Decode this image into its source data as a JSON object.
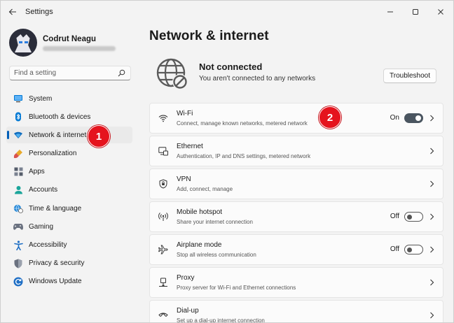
{
  "window": {
    "title": "Settings",
    "controls": [
      "minimize-icon",
      "maximize-icon",
      "close-icon"
    ]
  },
  "profile": {
    "name": "Codrut Neagu"
  },
  "search": {
    "placeholder": "Find a setting"
  },
  "sidebar": {
    "items": [
      {
        "label": "System",
        "icon": "system-icon"
      },
      {
        "label": "Bluetooth & devices",
        "icon": "bluetooth-icon"
      },
      {
        "label": "Network & internet",
        "icon": "network-icon",
        "active": true
      },
      {
        "label": "Personalization",
        "icon": "brush-icon"
      },
      {
        "label": "Apps",
        "icon": "apps-icon"
      },
      {
        "label": "Accounts",
        "icon": "person-icon"
      },
      {
        "label": "Time & language",
        "icon": "globe-clock-icon"
      },
      {
        "label": "Gaming",
        "icon": "gamepad-icon"
      },
      {
        "label": "Accessibility",
        "icon": "accessibility-icon"
      },
      {
        "label": "Privacy & security",
        "icon": "shield-icon"
      },
      {
        "label": "Windows Update",
        "icon": "update-icon"
      }
    ]
  },
  "annotations": {
    "badge1": "1",
    "badge2": "2",
    "color": "#e5131d"
  },
  "main": {
    "title": "Network & internet",
    "status": {
      "title": "Not connected",
      "subtitle": "You aren't connected to any networks",
      "button": "Troubleshoot"
    },
    "rows": [
      {
        "title": "Wi-Fi",
        "subtitle": "Connect, manage known networks, metered network",
        "icon": "wifi-icon",
        "toggle": "On"
      },
      {
        "title": "Ethernet",
        "subtitle": "Authentication, IP and DNS settings, metered network",
        "icon": "ethernet-icon"
      },
      {
        "title": "VPN",
        "subtitle": "Add, connect, manage",
        "icon": "vpn-shield-icon"
      },
      {
        "title": "Mobile hotspot",
        "subtitle": "Share your internet connection",
        "icon": "hotspot-icon",
        "toggle": "Off"
      },
      {
        "title": "Airplane mode",
        "subtitle": "Stop all wireless communication",
        "icon": "airplane-icon",
        "toggle": "Off"
      },
      {
        "title": "Proxy",
        "subtitle": "Proxy server for Wi-Fi and Ethernet connections",
        "icon": "proxy-icon"
      },
      {
        "title": "Dial-up",
        "subtitle": "Set up a dial-up internet connection",
        "icon": "dialup-icon"
      }
    ]
  },
  "colors": {
    "accent": "#005fb8",
    "toggle_on": "#4a5560"
  }
}
